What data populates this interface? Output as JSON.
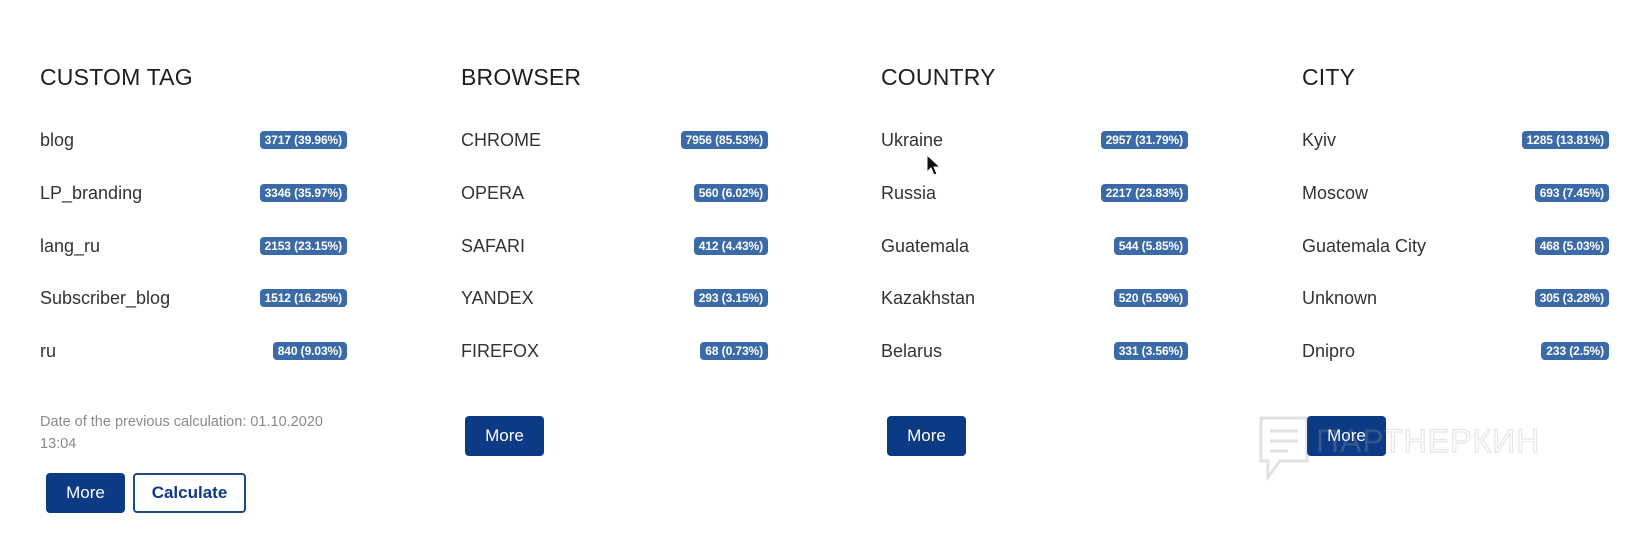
{
  "panels": [
    {
      "title": "CUSTOM TAG",
      "rows": [
        {
          "label": "blog",
          "value": "3717 (39.96%)"
        },
        {
          "label": "LP_branding",
          "value": "3346 (35.97%)"
        },
        {
          "label": "lang_ru",
          "value": "2153 (23.15%)"
        },
        {
          "label": "Subscriber_blog",
          "value": "1512 (16.25%)"
        },
        {
          "label": "ru",
          "value": "840 (9.03%)"
        }
      ],
      "calc_date": "Date of the previous calculation: 01.10.2020 13:04",
      "more_label": "More",
      "calculate_label": "Calculate"
    },
    {
      "title": "BROWSER",
      "rows": [
        {
          "label": "CHROME",
          "value": "7956 (85.53%)"
        },
        {
          "label": "OPERA",
          "value": "560 (6.02%)"
        },
        {
          "label": "SAFARI",
          "value": "412 (4.43%)"
        },
        {
          "label": "YANDEX",
          "value": "293 (3.15%)"
        },
        {
          "label": "FIREFOX",
          "value": "68 (0.73%)"
        }
      ],
      "more_label": "More"
    },
    {
      "title": "COUNTRY",
      "rows": [
        {
          "label": "Ukraine",
          "value": "2957 (31.79%)"
        },
        {
          "label": "Russia",
          "value": "2217 (23.83%)"
        },
        {
          "label": "Guatemala",
          "value": "544 (5.85%)"
        },
        {
          "label": "Kazakhstan",
          "value": "520 (5.59%)"
        },
        {
          "label": "Belarus",
          "value": "331 (3.56%)"
        }
      ],
      "more_label": "More"
    },
    {
      "title": "CITY",
      "rows": [
        {
          "label": "Kyiv",
          "value": "1285 (13.81%)"
        },
        {
          "label": "Moscow",
          "value": "693 (7.45%)"
        },
        {
          "label": "Guatemala City",
          "value": "468 (5.03%)"
        },
        {
          "label": "Unknown",
          "value": "305 (3.28%)"
        },
        {
          "label": "Dnipro",
          "value": "233 (2.5%)"
        }
      ],
      "more_label": "More"
    }
  ],
  "watermark": {
    "text": "ПАРТНЕРКИН"
  },
  "colors": {
    "badge": "#3b6aa8",
    "primary_button": "#0d3a85",
    "outline_border": "#1c4a8f"
  }
}
